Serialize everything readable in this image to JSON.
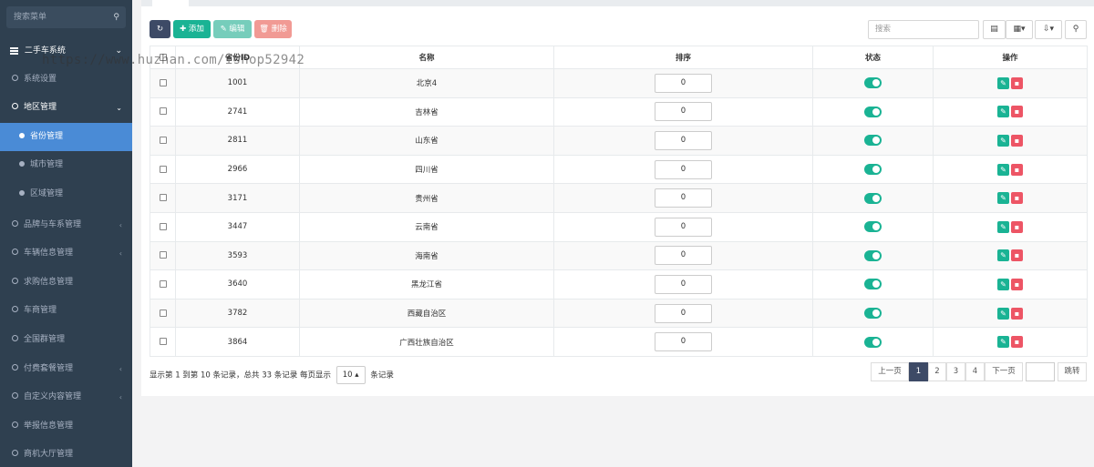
{
  "sidebar": {
    "search_placeholder": "搜索菜单",
    "search_icon": "search-icon",
    "header": "二手车系统",
    "items": [
      {
        "label": "系统设置",
        "level": 1
      },
      {
        "label": "地区管理",
        "level": 1,
        "expanded": true
      },
      {
        "label": "省份管理",
        "level": 2,
        "active": true
      },
      {
        "label": "城市管理",
        "level": 2
      },
      {
        "label": "区域管理",
        "level": 2
      },
      {
        "label": "品牌与车系管理",
        "level": 1,
        "has_children": true
      },
      {
        "label": "车辆信息管理",
        "level": 1,
        "has_children": true
      },
      {
        "label": "求购信息管理",
        "level": 1
      },
      {
        "label": "车商管理",
        "level": 1
      },
      {
        "label": "全国群管理",
        "level": 1
      },
      {
        "label": "付费套餐管理",
        "level": 1,
        "has_children": true
      },
      {
        "label": "自定义内容管理",
        "level": 1,
        "has_children": true
      },
      {
        "label": "举报信息管理",
        "level": 1
      },
      {
        "label": "商机大厅管理",
        "level": 1
      }
    ]
  },
  "watermark": "https://www.huzhan.com/ishop52942",
  "toolbar": {
    "refresh_icon": "refresh-icon",
    "add_label": "✚ 添加",
    "edit_label": "✎ 编辑",
    "delete_label": "🗑 删除",
    "search_placeholder": "搜索"
  },
  "table": {
    "headers": [
      "",
      "省份ID",
      "名称",
      "排序",
      "状态",
      "操作"
    ],
    "rows": [
      {
        "id": "1001",
        "name": "北京4",
        "sort": "0",
        "status": true
      },
      {
        "id": "2741",
        "name": "吉林省",
        "sort": "0",
        "status": true
      },
      {
        "id": "2811",
        "name": "山东省",
        "sort": "0",
        "status": true
      },
      {
        "id": "2966",
        "name": "四川省",
        "sort": "0",
        "status": true
      },
      {
        "id": "3171",
        "name": "贵州省",
        "sort": "0",
        "status": true
      },
      {
        "id": "3447",
        "name": "云南省",
        "sort": "0",
        "status": true
      },
      {
        "id": "3593",
        "name": "海南省",
        "sort": "0",
        "status": true
      },
      {
        "id": "3640",
        "name": "黑龙江省",
        "sort": "0",
        "status": true
      },
      {
        "id": "3782",
        "name": "西藏自治区",
        "sort": "0",
        "status": true
      },
      {
        "id": "3864",
        "name": "广西壮族自治区",
        "sort": "0",
        "status": true
      }
    ]
  },
  "footer": {
    "info_prefix": "显示第 1 到第 10 条记录，总共 33 条记录 每页显示",
    "page_size": "10 ▴",
    "info_suffix": "条记录"
  },
  "pagination": {
    "prev": "上一页",
    "pages": [
      "1",
      "2",
      "3",
      "4"
    ],
    "current": "1",
    "next": "下一页",
    "jump": "跳转"
  },
  "colors": {
    "sidebar_bg": "#2f4050",
    "active_menu": "#4a8bd6",
    "primary_green": "#1ab394",
    "danger_red": "#ed5565",
    "dark_button": "#3d4a66"
  }
}
